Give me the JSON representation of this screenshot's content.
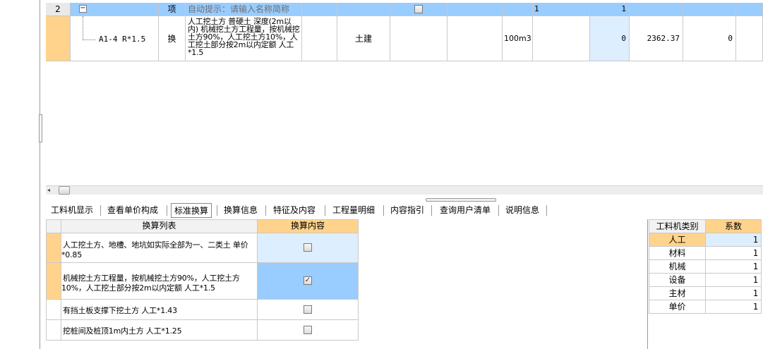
{
  "grid": {
    "row1": {
      "index": "2",
      "expand_glyph": "−",
      "type": "项",
      "hint": "自动提示：请输入名称简称",
      "qty_a": "1",
      "qty_b": "1",
      "checked": false
    },
    "row2": {
      "code": "A1-4 R*1.5",
      "type": "换",
      "description": "人工挖土方 普硬土 深度(2m以内) 机械挖土方工程量，按机械挖土方90%，人工挖土方10%，人工挖土部分按2m以内定额 人工*1.5",
      "specialty": "土建",
      "unit": "100m3",
      "qty": "0",
      "price": "2362.37",
      "total": "0"
    }
  },
  "tabs": [
    {
      "label": "工料机显示"
    },
    {
      "label": "查看单价构成"
    },
    {
      "label": "标准换算",
      "active": true
    },
    {
      "label": "换算信息"
    },
    {
      "label": "特征及内容"
    },
    {
      "label": "工程量明细"
    },
    {
      "label": "内容指引"
    },
    {
      "label": "查询用户清单"
    },
    {
      "label": "说明信息"
    }
  ],
  "conversion_table": {
    "col_list": "换算列表",
    "col_content": "换算内容",
    "rows": [
      {
        "text": "人工挖土方、地槽、地坑如实际全部为一、二类土 单价*0.85",
        "checked": false
      },
      {
        "text": "机械挖土方工程量，按机械挖土方90%，人工挖土方10%，人工挖土部分按2m以内定额 人工*1.5",
        "checked": true
      },
      {
        "text": "有挡土板支撑下挖土方 人工*1.43",
        "checked": false
      },
      {
        "text": "挖桩间及桩顶1m内土方 人工*1.25",
        "checked": false
      }
    ]
  },
  "coef_table": {
    "col_category": "工料机类别",
    "col_coef": "系数",
    "rows": [
      {
        "category": "人工",
        "coef": "1"
      },
      {
        "category": "材料",
        "coef": "1"
      },
      {
        "category": "机械",
        "coef": "1"
      },
      {
        "category": "设备",
        "coef": "1"
      },
      {
        "category": "主材",
        "coef": "1"
      },
      {
        "category": "单价",
        "coef": "1"
      }
    ]
  },
  "colors": {
    "selected_row": "#99ccff",
    "header_orange": "#ffd38c",
    "light_blue": "#ddeeff"
  }
}
